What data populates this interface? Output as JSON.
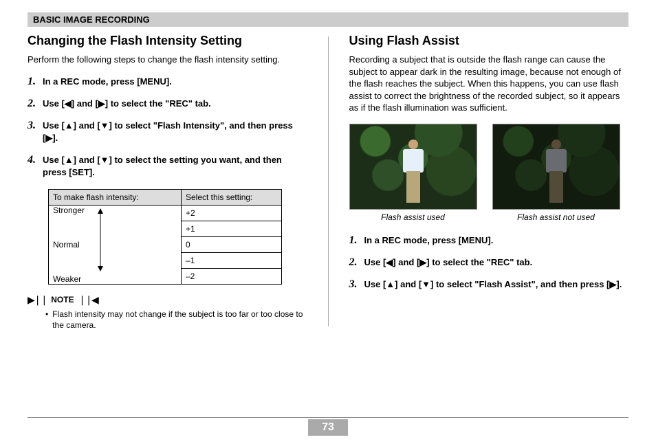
{
  "header": "BASIC IMAGE RECORDING",
  "left": {
    "title": "Changing the Flash Intensity Setting",
    "intro": "Perform the following steps to change the flash intensity setting.",
    "steps": [
      "In a REC mode, press [MENU].",
      "Use [◀] and [▶] to select the \"REC\" tab.",
      "Use [▲] and [▼] to select \"Flash Intensity\", and then press [▶].",
      "Use [▲] and [▼] to select the setting you want, and then press [SET]."
    ],
    "table": {
      "head": [
        "To make flash intensity:",
        "Select this setting:"
      ],
      "labels": {
        "stronger": "Stronger",
        "normal": "Normal",
        "weaker": "Weaker"
      },
      "values": [
        "+2",
        "+1",
        " 0",
        "–1",
        "–2"
      ]
    },
    "note_label": "NOTE",
    "note": "Flash intensity may not change if the subject is too far or too close to the camera."
  },
  "right": {
    "title": "Using Flash Assist",
    "intro": "Recording a subject that is outside the flash range can cause the subject to appear dark in the resulting image, because not enough of the flash reaches the subject. When this happens, you can use flash assist to correct the brightness of the recorded subject, so it appears as if the flash illumination was sufficient.",
    "captions": [
      "Flash assist used",
      "Flash assist not used"
    ],
    "steps": [
      "In a REC mode, press [MENU].",
      "Use [◀] and [▶] to select the \"REC\" tab.",
      "Use [▲] and [▼] to select \"Flash Assist\", and then press [▶]."
    ]
  },
  "page_number": "73"
}
